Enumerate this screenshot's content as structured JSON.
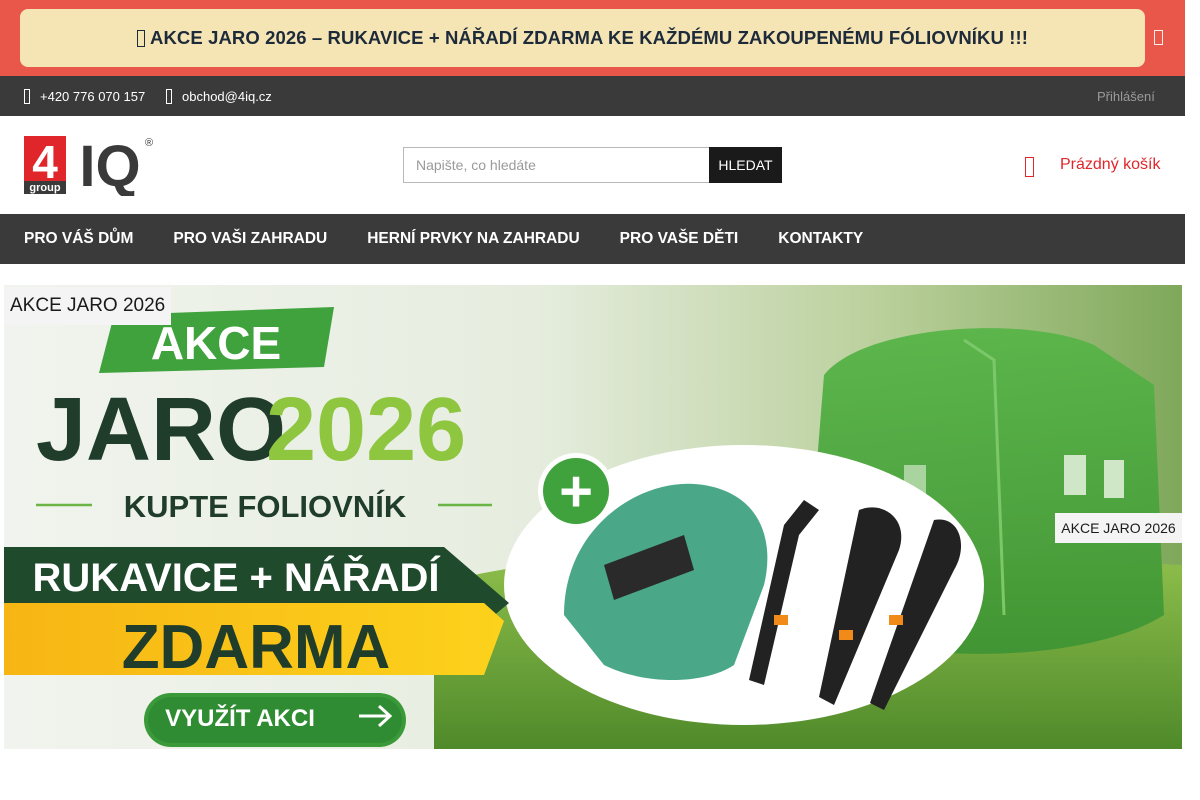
{
  "promo": {
    "text": "AKCE JARO 2026 – RUKAVICE + NÁŘADÍ ZDARMA KE KAŽDÉMU ZAKOUPENÉMU FÓLIOVNÍKU !!!",
    "icon": "gift-icon",
    "close_icon": "close-icon",
    "bar_color": "#e8574a",
    "box_color": "#f6e5b4"
  },
  "topbar": {
    "phone": "+420 776 070 157",
    "email": "obchod@4iq.cz",
    "login": "Přihlášení",
    "phone_icon": "phone-icon",
    "email_icon": "envelope-icon"
  },
  "header": {
    "logo": {
      "main": "4",
      "iq": "IQ",
      "group": "group",
      "reg": "®"
    },
    "search_placeholder": "Napište, co hledáte",
    "search_button": "HLEDAT",
    "cart_label": "Prázdný košík",
    "cart_icon": "cart-icon",
    "accent": "#e0262b"
  },
  "nav": {
    "items": [
      "PRO VÁŠ DŮM",
      "PRO VAŠI ZAHRADU",
      "HERNÍ PRVKY NA ZAHRADU",
      "PRO VAŠE DĚTI",
      "KONTAKTY"
    ]
  },
  "banner": {
    "label": "AKCE JARO 2026",
    "label_right": "AKCE JARO 2026",
    "line1": "AKCE",
    "line2a": "JARO",
    "line2b": "2026",
    "line3": "KUPTE FOLIOVNÍK",
    "line4": "RUKAVICE + NÁŘADÍ",
    "line5": "ZDARMA",
    "cta": "VYUŽÍT AKCI",
    "plus": "+"
  }
}
